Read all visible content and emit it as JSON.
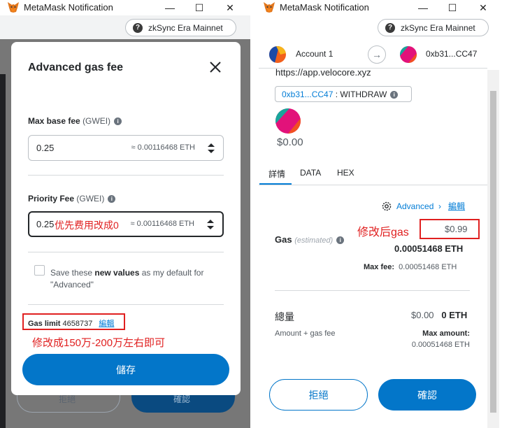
{
  "left_window": {
    "title": "MetaMask Notification",
    "network": "zkSync Era Mainnet",
    "modal": {
      "title": "Advanced gas fee",
      "max_base_fee": {
        "label": "Max base fee",
        "unit": "(GWEI)",
        "value": "0.25",
        "eth": "≈ 0.00116468 ETH"
      },
      "priority_fee": {
        "label": "Priority Fee",
        "unit": "(GWEI)",
        "value": "0.25",
        "eth": "≈ 0.00116468 ETH"
      },
      "checkbox_text_pre": "Save these ",
      "checkbox_text_bold": "new values",
      "checkbox_text_post": " as my default for \"Advanced\"",
      "gas_limit_label": "Gas limit",
      "gas_limit_value": "4658737",
      "gas_limit_edit": "編輯",
      "save_label": "儲存"
    },
    "behind_buttons": {
      "reject": "拒絕",
      "confirm": "確認"
    }
  },
  "right_window": {
    "title": "MetaMask Notification",
    "network": "zkSync Era Mainnet",
    "from_account": "Account 1",
    "to_address": "0xb31...CC47",
    "origin": "https://app.velocore.xyz",
    "method_address": "0xb31...CC47",
    "method_name": ": WITHDRAW",
    "amount": "$0.00",
    "tabs": [
      "詳情",
      "DATA",
      "HEX"
    ],
    "advanced_link": "Advanced",
    "edit_link": "編輯",
    "gas_label": "Gas",
    "gas_estimated": "(estimated)",
    "gas_usd": "$0.99",
    "gas_eth": "0.00051468 ETH",
    "max_fee_label": "Max fee:",
    "max_fee_value": "0.00051468 ETH",
    "total_label": "總量",
    "total_usd": "$0.00",
    "total_eth": "0 ETH",
    "total_sub": "Amount + gas fee",
    "max_amount_label": "Max amount:",
    "max_amount_value": "0.00051468 ETH",
    "reject_label": "拒絕",
    "confirm_label": "確認"
  },
  "annotations": {
    "priority_note": "优先费用改成0",
    "gas_limit_note": "修改成150万-200万左右即可",
    "gas_note": "修改后gas"
  },
  "colors": {
    "brand_blue": "#0376c9",
    "annotation_red": "#e02020",
    "link_blue": "#037dd6"
  }
}
